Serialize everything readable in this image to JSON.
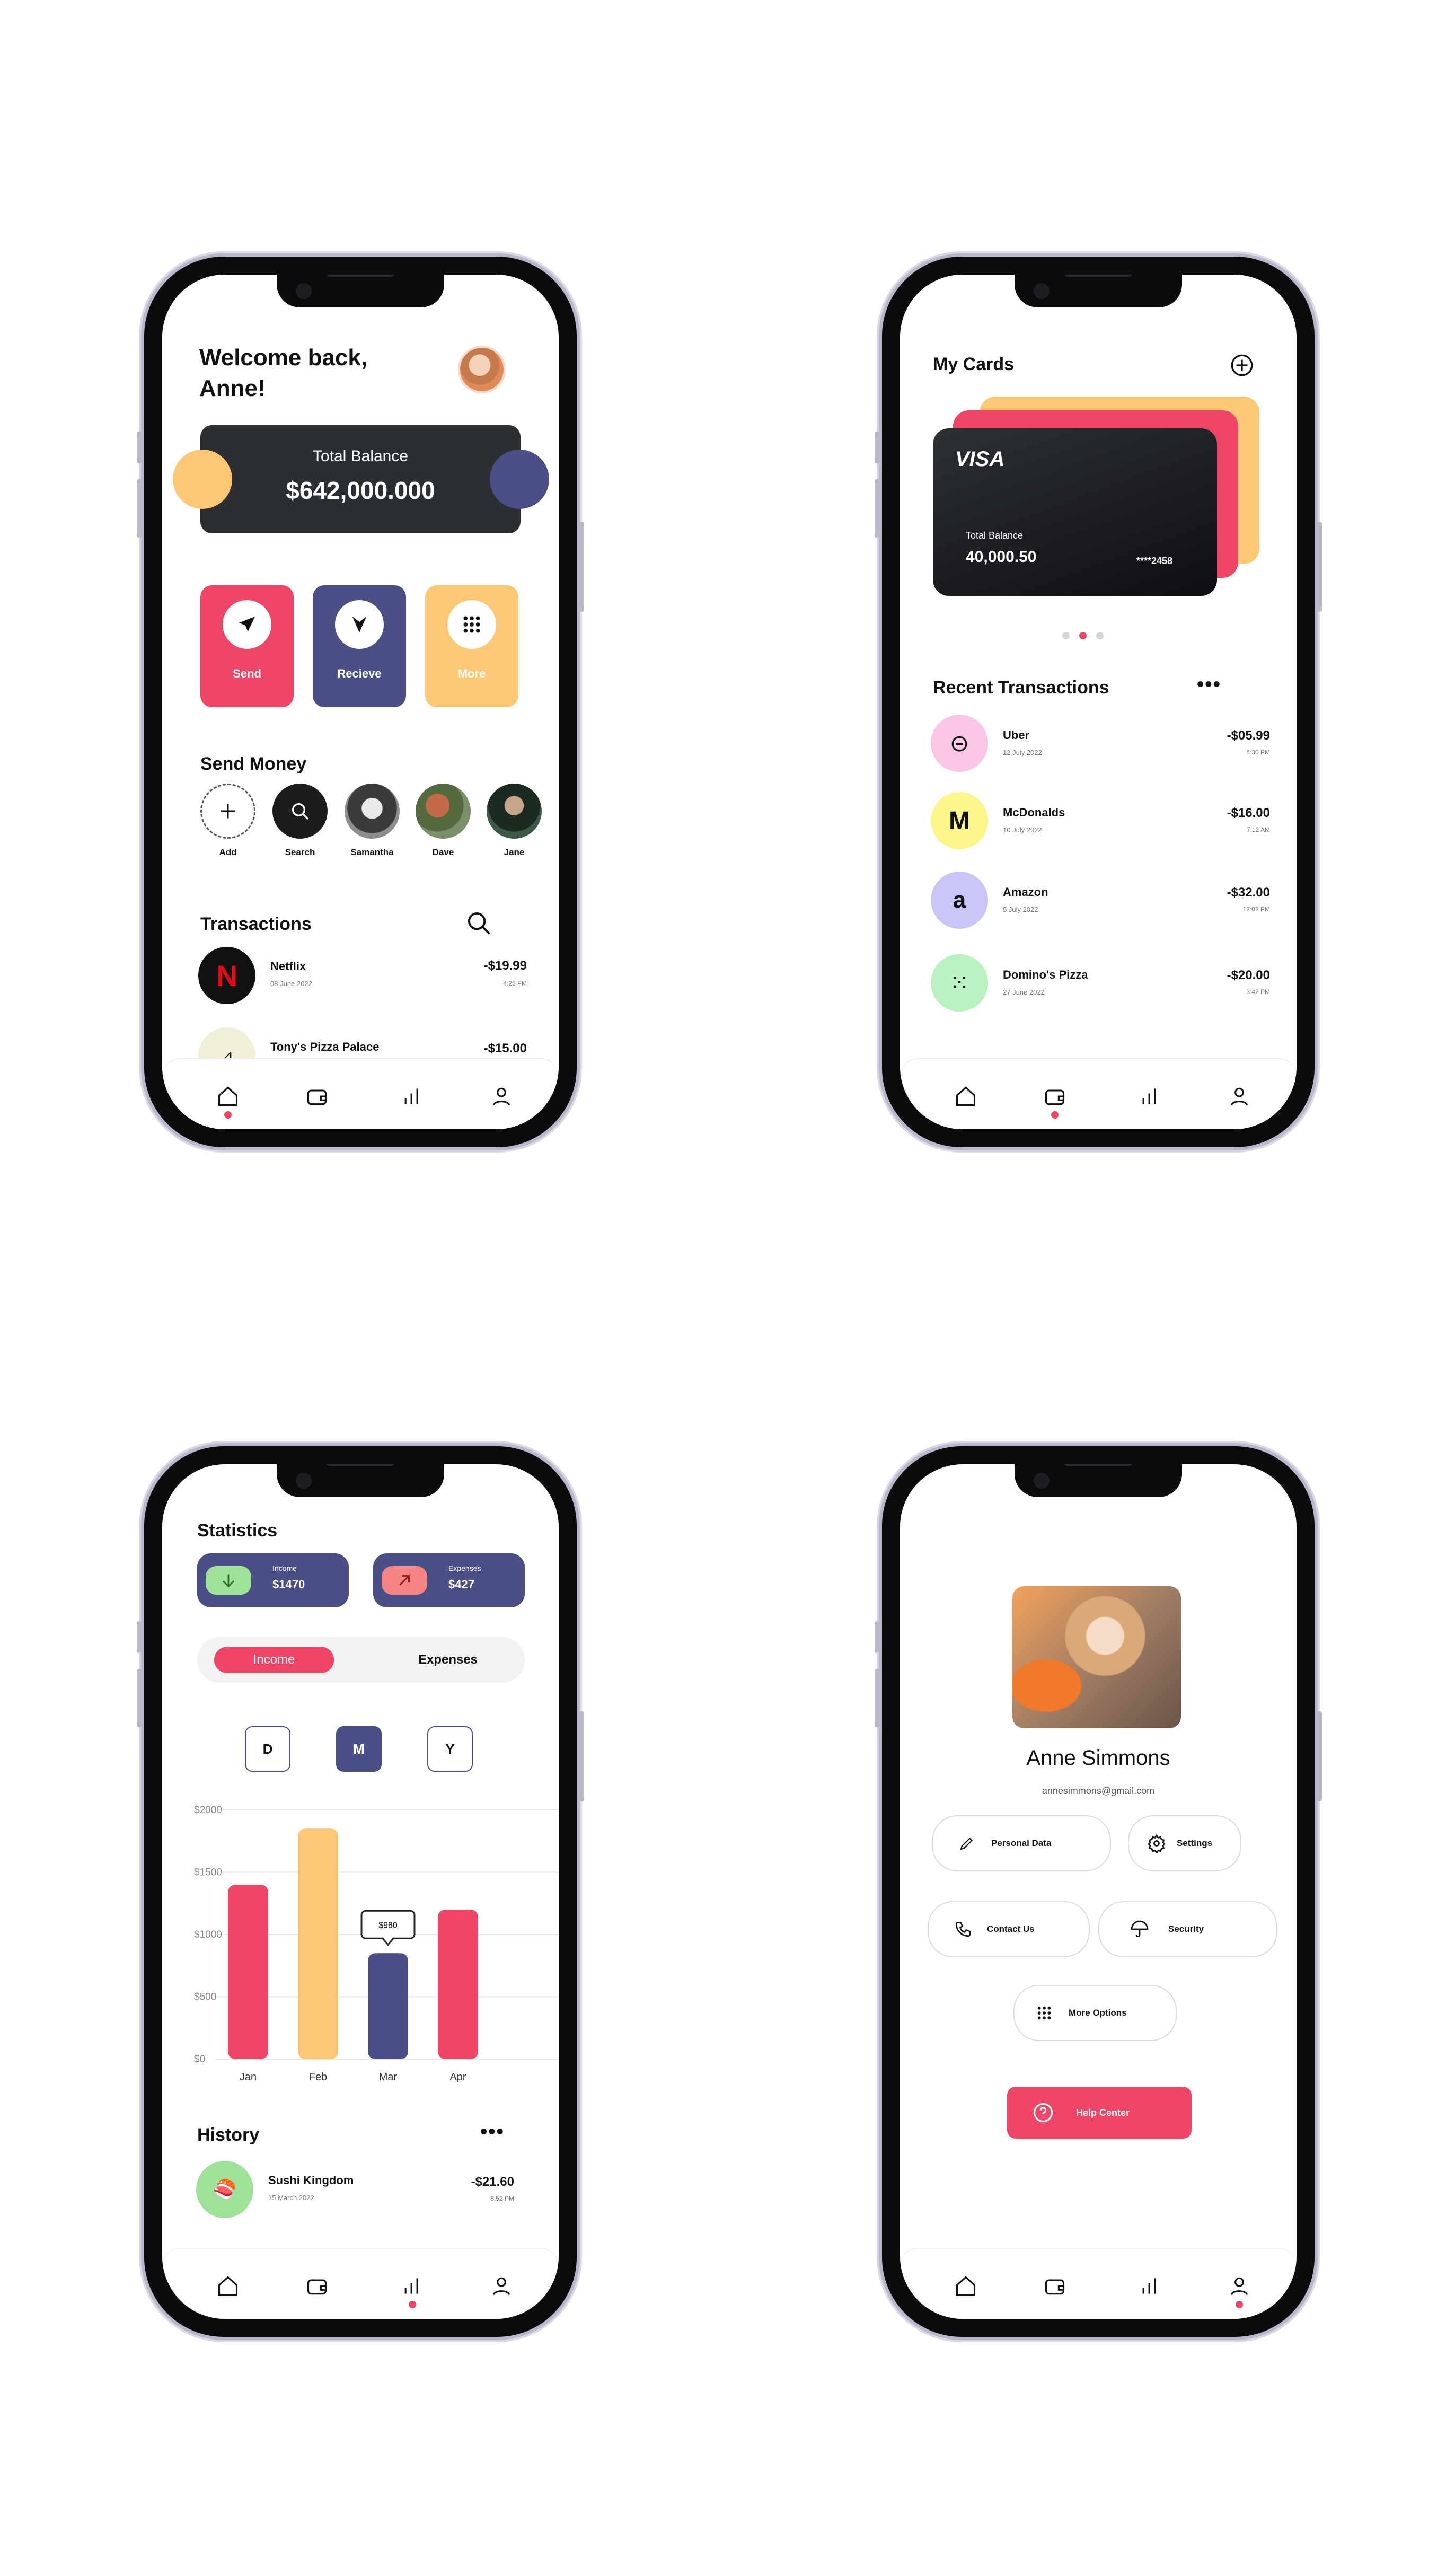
{
  "screen_home": {
    "greeting_line1": "Welcome back,",
    "greeting_line2": "Anne!",
    "balance_label": "Total Balance",
    "balance_value": "$642,000.000",
    "actions": [
      {
        "label": "Send",
        "icon": "send-icon",
        "color": "#ef4566"
      },
      {
        "label": "Recieve",
        "icon": "receive-icon",
        "color": "#4b4f85"
      },
      {
        "label": "More",
        "icon": "grid-icon",
        "color": "#fdc875"
      }
    ],
    "send_money_title": "Send Money",
    "contacts": [
      "Add",
      "Search",
      "Samantha",
      "Dave",
      "Jane"
    ],
    "transactions_title": "Transactions",
    "transactions": [
      {
        "name": "Netflix",
        "date": "08 June 2022",
        "amount": "-$19.99",
        "time": "4:25 PM"
      },
      {
        "name": "Tony's Pizza Palace",
        "date": "",
        "amount": "-$15.00",
        "time": ""
      }
    ]
  },
  "screen_cards": {
    "title": "My Cards",
    "card_brand": "VISA",
    "card_balance_label": "Total Balance",
    "card_balance": "40,000.50",
    "card_number": "****2458",
    "recent_title": "Recent Transactions",
    "transactions": [
      {
        "name": "Uber",
        "date": "12 July 2022",
        "amount": "-$05.99",
        "time": "6:30 PM",
        "icon_bg": "#f9c6e6",
        "icon_glyph": "⊝"
      },
      {
        "name": "McDonalds",
        "date": "10 July 2022",
        "amount": "-$16.00",
        "time": "7:12 AM",
        "icon_bg": "#fbf58a",
        "icon_glyph": "M"
      },
      {
        "name": "Amazon",
        "date": "5 July 2022",
        "amount": "-$32.00",
        "time": "12:02 PM",
        "icon_bg": "#c9c6f7",
        "icon_glyph": "a"
      },
      {
        "name": "Domino's Pizza",
        "date": "27 June 2022",
        "amount": "-$20.00",
        "time": "3:42 PM",
        "icon_bg": "#b9f1c0",
        "icon_glyph": "⁙"
      }
    ]
  },
  "screen_stats": {
    "title": "Statistics",
    "income_label": "Income",
    "income_value": "$1470",
    "expenses_label": "Expenses",
    "expenses_value": "$427",
    "toggle": [
      "Income",
      "Expenses"
    ],
    "periods": [
      "D",
      "M",
      "Y"
    ],
    "history_title": "History",
    "history": [
      {
        "name": "Sushi Kingdom",
        "date": "15 March 2022",
        "amount": "-$21.60",
        "time": "8:52 PM"
      }
    ]
  },
  "chart_data": {
    "type": "bar",
    "categories": [
      "Jan",
      "Feb",
      "Mar",
      "Apr"
    ],
    "values": [
      1400,
      1850,
      850,
      1200
    ],
    "colors": [
      "#ef4566",
      "#fdc875",
      "#4b4f85",
      "#ef4566"
    ],
    "y_ticks": [
      "$2000",
      "$1500",
      "$1000",
      "$500",
      "$0"
    ],
    "ylim": [
      0,
      2000
    ],
    "tooltip": "$980",
    "grid": true
  },
  "screen_profile": {
    "name": "Anne Simmons",
    "email": "annesimmons@gmail.com",
    "buttons": [
      {
        "label": "Personal Data",
        "icon": "pencil-icon"
      },
      {
        "label": "Settings",
        "icon": "gear-icon"
      },
      {
        "label": "Contact Us",
        "icon": "phone-icon"
      },
      {
        "label": "Security",
        "icon": "umbrella-icon"
      },
      {
        "label": "More Options",
        "icon": "grid-icon"
      }
    ],
    "help": "Help Center"
  },
  "colors": {
    "accent": "#ef4566",
    "navy": "#4b4f85",
    "yellow": "#fdc875",
    "dark": "#2b2e33"
  }
}
